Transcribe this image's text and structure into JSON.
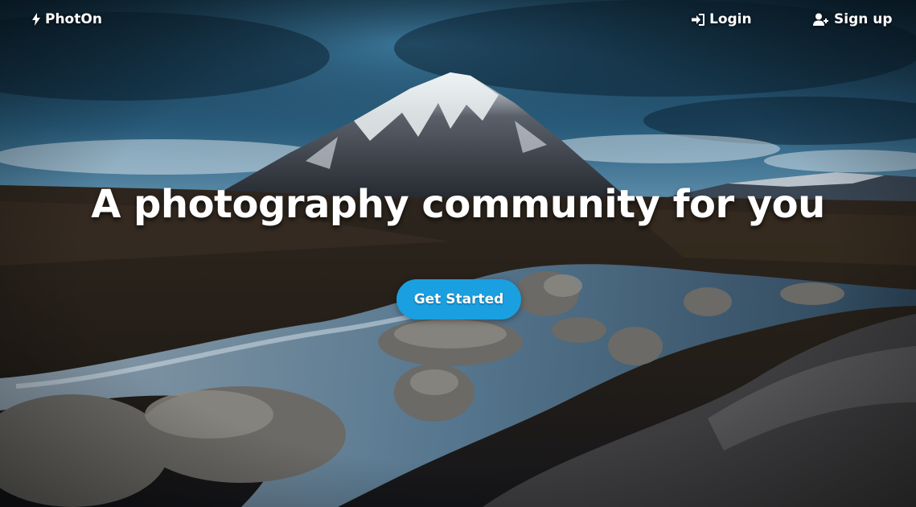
{
  "nav": {
    "brand": "PhotOn",
    "brand_icon": "bolt-icon",
    "login_label": "Login",
    "login_icon": "sign-in-icon",
    "signup_label": "Sign up",
    "signup_icon": "user-plus-icon"
  },
  "hero": {
    "headline": "A photography community for you",
    "cta_label": "Get Started",
    "background": "mountain-river-landscape-photo"
  },
  "colors": {
    "cta": "#1a9fe0",
    "text": "#ffffff"
  }
}
